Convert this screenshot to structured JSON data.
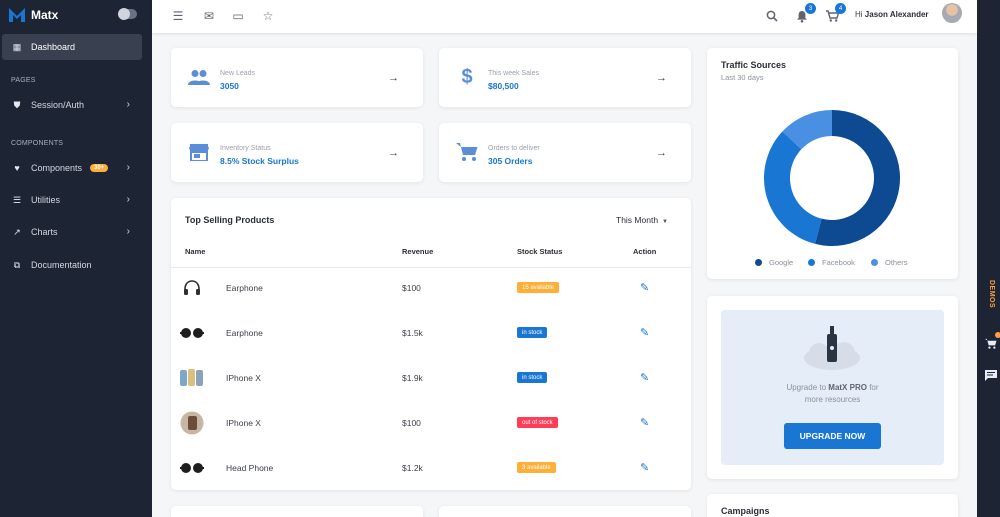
{
  "brand": {
    "name": "Matx"
  },
  "sidebar": {
    "dashboard": "Dashboard",
    "section_pages": "PAGES",
    "session_auth": "Session/Auth",
    "section_components": "COMPONENTS",
    "components": "Components",
    "components_badge": "30+",
    "utilities": "Utilities",
    "charts": "Charts",
    "documentation": "Documentation"
  },
  "topbar": {
    "notifications_count": "3",
    "cart_count": "4",
    "greeting": "Hi",
    "user_name": "Jason Alexander"
  },
  "stats": [
    {
      "label": "New Leads",
      "value": "3050",
      "icon": "group-icon"
    },
    {
      "label": "This week Sales",
      "value": "$80,500",
      "icon": "dollar-icon"
    },
    {
      "label": "Inventory Status",
      "value": "8.5% Stock Surplus",
      "icon": "store-icon"
    },
    {
      "label": "Orders to deliver",
      "value": "305 Orders",
      "icon": "cart-icon"
    }
  ],
  "products": {
    "title": "Top Selling Products",
    "period": "This Month",
    "columns": {
      "name": "Name",
      "revenue": "Revenue",
      "stock": "Stock Status",
      "action": "Action"
    },
    "rows": [
      {
        "name": "Earphone",
        "revenue": "$100",
        "stock": "15 available",
        "stock_color": "#ffaf38"
      },
      {
        "name": "Earphone",
        "revenue": "$1.5k",
        "stock": "in stock",
        "stock_color": "#1976d2"
      },
      {
        "name": "IPhone X",
        "revenue": "$1.9k",
        "stock": "in stock",
        "stock_color": "#1976d2"
      },
      {
        "name": "IPhone X",
        "revenue": "$100",
        "stock": "out of stock",
        "stock_color": "#ff3d57"
      },
      {
        "name": "Head Phone",
        "revenue": "$1.2k",
        "stock": "3 available",
        "stock_color": "#ffaf38"
      }
    ]
  },
  "traffic": {
    "title": "Traffic Sources",
    "subtitle": "Last 30 days",
    "legend": [
      {
        "name": "Google",
        "color": "#0d4a91"
      },
      {
        "name": "Facebook",
        "color": "#1976d2"
      },
      {
        "name": "Others",
        "color": "#4a90e2"
      }
    ]
  },
  "chart_data": {
    "type": "pie",
    "categories": [
      "Google",
      "Facebook",
      "Others"
    ],
    "values": [
      54,
      33,
      13
    ],
    "title": "Traffic Sources",
    "colors": [
      "#0d4a91",
      "#1976d2",
      "#4a90e2"
    ]
  },
  "upgrade": {
    "text_prefix": "Upgrade to",
    "product": "MatX PRO",
    "text_suffix": "for",
    "text_line2": "more resources",
    "button": "UPGRADE NOW"
  },
  "campaigns": {
    "title": "Campaigns"
  },
  "right_strip": {
    "demos": "DEMOS"
  }
}
